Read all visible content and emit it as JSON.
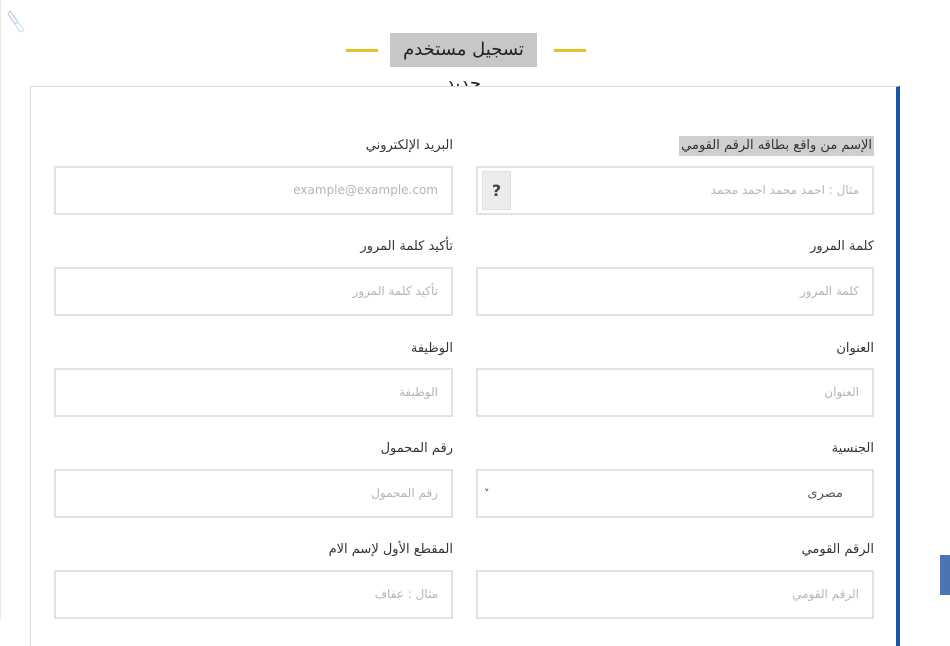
{
  "colors": {
    "accent": "#e2c12a",
    "panel_border": "#1a56a6",
    "title_bg": "#c7c7c7"
  },
  "page": {
    "title": "تسجيل مستخدم جديد"
  },
  "form": {
    "full_name": {
      "label": "الإسم من واقع بطاقه الرقم القومي",
      "placeholder": "مثال : احمد محمد احمد محمد",
      "help": "?"
    },
    "email": {
      "label": "البريد الإلكتروني",
      "placeholder": "example@example.com"
    },
    "password": {
      "label": "كلمة المرور",
      "placeholder": "كلمة المرور"
    },
    "confirm_password": {
      "label": "تأكيد كلمة المرور",
      "placeholder": "تأكيد كلمة المرور"
    },
    "address": {
      "label": "العنوان",
      "placeholder": "العنوان"
    },
    "job": {
      "label": "الوظيفة",
      "placeholder": "الوظيفة"
    },
    "nationality": {
      "label": "الجنسية",
      "selected": "مصرى",
      "chevron": "˅"
    },
    "mobile": {
      "label": "رقم المحمول",
      "placeholder": "رقم المحمول"
    },
    "national_id": {
      "label": "الرقم القومي",
      "placeholder": "الرقم القومي"
    },
    "mother_name": {
      "label": "المقطع الأول لإسم الام",
      "placeholder": "مثال : عفاف"
    }
  }
}
